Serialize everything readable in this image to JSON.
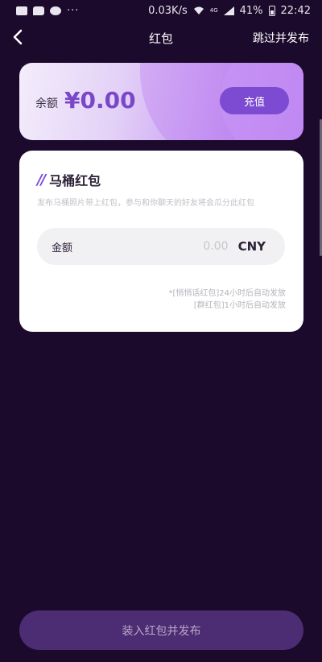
{
  "status_bar": {
    "speed": "0.03K/s",
    "network": "4G",
    "battery": "41%",
    "time": "22:42",
    "dots": "···"
  },
  "nav": {
    "title": "红包",
    "action": "跳过并发布"
  },
  "balance": {
    "label": "余额",
    "amount": "¥0.00",
    "recharge_label": "充值"
  },
  "packet": {
    "title": "马桶红包",
    "description": "发布马桶照片带上红包，参与和你聊天的好友将会瓜分此红包",
    "amount_label": "金额",
    "amount_placeholder": "0.00",
    "currency": "CNY",
    "notes": [
      "*[悄悄话红包]24小时后自动发放",
      "[群红包]1小时后自动发放"
    ]
  },
  "publish_label": "装入红包并发布",
  "colors": {
    "background": "#1b0a2b",
    "accent": "#7d4ad2",
    "publish_button": "#4c2c72"
  }
}
